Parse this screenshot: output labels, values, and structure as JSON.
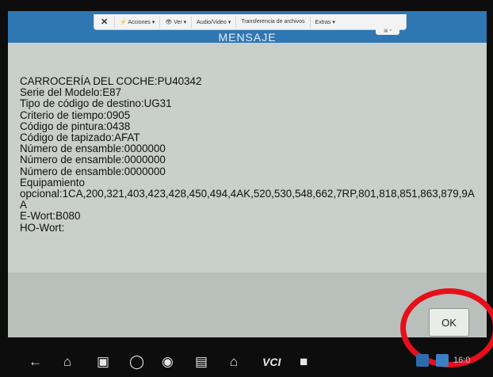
{
  "toolbar": {
    "close_label": "✕",
    "acciones_label": "⚡ Acciones ▾",
    "ver_label": "👁 Ver ▾",
    "audio_label": "Audio/Video ▾",
    "transfer_label": "Transferencia de archivos",
    "extras_label": "Extras ▾",
    "sub_label": "⌘ ^"
  },
  "dialog": {
    "title": "MENSAJE",
    "lines": [
      "CARROCERÍA DEL COCHE:PU40342",
      "Serie del Modelo:E87",
      "Tipo de código de destino:UG31",
      "Criterio de tiempo:0905",
      "Código de pintura:0438",
      "Código de tapizado:AFAT",
      "Número de ensamble:0000000",
      "Número de ensamble:0000000",
      "Número de ensamble:0000000",
      "Equipamiento",
      "opcional:1CA,200,321,403,423,428,450,494,4AK,520,530,548,662,7RP,801,818,851,863,879,9AA",
      "E-Wort:B080",
      "HO-Wort:"
    ],
    "ok_label": "OK"
  },
  "navbar": {
    "back_icon": "back-arrow-icon",
    "home_icon": "home-icon",
    "recent_icon": "recent-apps-icon",
    "vci_label": "VCI",
    "time_label": "16:0"
  },
  "colors": {
    "titlebar": "#2f77b3",
    "content_bg": "#c9cfca",
    "bottom_bg": "#b9bfba",
    "highlight_circle": "#e60f1a"
  }
}
